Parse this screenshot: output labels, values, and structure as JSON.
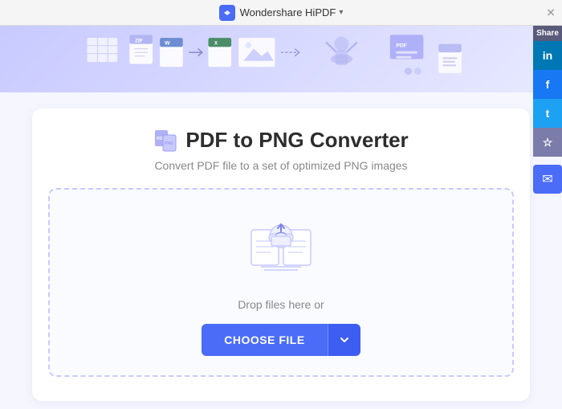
{
  "titlebar": {
    "title": "Wondershare HiPDF",
    "close_label": "✕"
  },
  "hero": {
    "alt": "PDF conversion illustration"
  },
  "converter": {
    "title": "PDF to PNG Converter",
    "subtitle": "Convert PDF file to a set of optimized PNG images",
    "drop_text": "Drop files here or",
    "choose_file_label": "CHOOSE FILE"
  },
  "sidebar": {
    "share_label": "Share",
    "linkedin_icon": "in",
    "facebook_icon": "f",
    "twitter_icon": "t",
    "star_icon": "☆",
    "email_icon": "✉"
  }
}
